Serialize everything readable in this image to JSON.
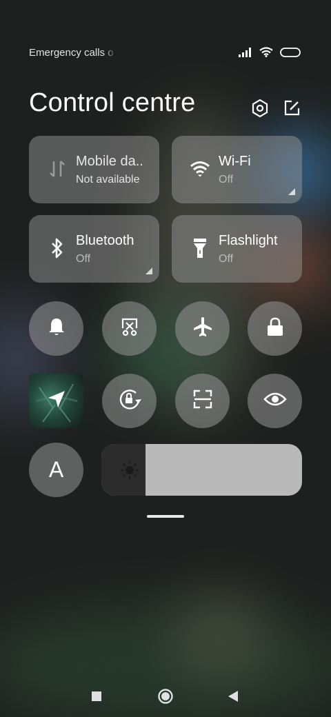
{
  "status": {
    "carrier_text": "Emergency calls o",
    "icons": [
      "signal-icon",
      "wifi-icon",
      "battery-icon"
    ]
  },
  "header": {
    "title": "Control centre",
    "icons": [
      "settings-icon",
      "edit-icon"
    ]
  },
  "tiles": [
    {
      "label": "Mobile da..",
      "status": "Not available",
      "icon": "mobile-data-icon"
    },
    {
      "label": "Wi-Fi",
      "status": "Off",
      "icon": "wifi-icon"
    },
    {
      "label": "Bluetooth",
      "status": "Off",
      "icon": "bluetooth-icon"
    },
    {
      "label": "Flashlight",
      "status": "Off",
      "icon": "flashlight-icon"
    }
  ],
  "toggles": [
    "bell-icon",
    "screen-cast-icon",
    "airplane-icon",
    "lock-icon",
    "location-icon",
    "auto-rotate-icon",
    "scan-icon",
    "eye-icon",
    "auto-brightness-icon"
  ],
  "auto_brightness_label": "A",
  "brightness_level": 0.22,
  "navigation": [
    "recents-icon",
    "home-icon",
    "back-icon"
  ],
  "colors": {
    "background": "#1e201f",
    "tile_off": "#8a8a8a",
    "slider_track": "#b9b9b9"
  }
}
